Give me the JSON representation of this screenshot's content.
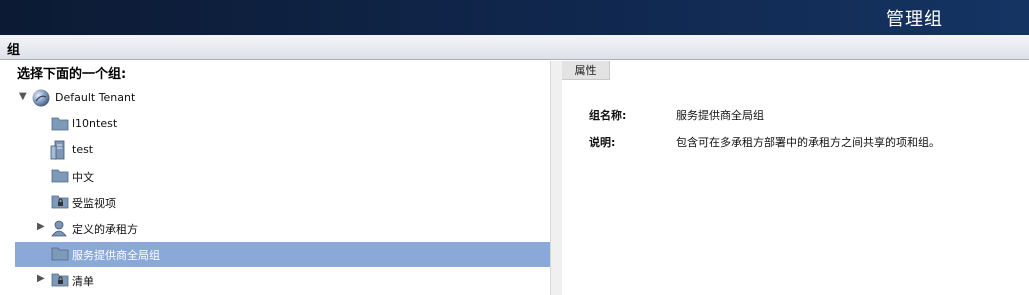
{
  "header": {
    "title": "管理组"
  },
  "section": {
    "label": "组"
  },
  "tree": {
    "prompt": "选择下面的一个组:",
    "items": [
      {
        "label": "Default Tenant",
        "icon": "globe-icon"
      },
      {
        "label": "l10ntest",
        "icon": "folder-icon"
      },
      {
        "label": "test",
        "icon": "server-icon"
      },
      {
        "label": "中文",
        "icon": "folder-icon"
      },
      {
        "label": "受监视项",
        "icon": "locked-folder-icon"
      },
      {
        "label": "定义的承租方",
        "icon": "user-icon"
      },
      {
        "label": "服务提供商全局组",
        "icon": "folder-icon",
        "selected": true
      },
      {
        "label": "清单",
        "icon": "locked-folder-icon"
      }
    ]
  },
  "properties": {
    "tab_label": "属性",
    "group_name_label": "组名称:",
    "group_name_value": "服务提供商全局组",
    "description_label": "说明:",
    "description_value": "包含可在多承租方部署中的承租方之间共享的项和组。"
  },
  "colors": {
    "header_bg": "#10274d",
    "selection": "#8aa9d8"
  }
}
